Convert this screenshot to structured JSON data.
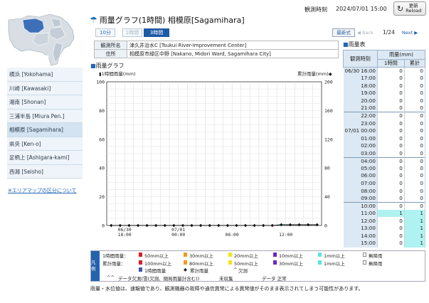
{
  "header": {
    "obs_time_label": "観測時刻",
    "obs_time_value": "2024/07/01 15:00",
    "reload_label_jp": "更新",
    "reload_label_en": "Reload"
  },
  "title": "雨量グラフ(1時間) 相模原[Sagamihara]",
  "tabs": [
    {
      "label": "10分",
      "state": "link"
    },
    {
      "label": "1時間",
      "state": "disabled"
    },
    {
      "label": "3時間",
      "state": "active"
    }
  ],
  "pager": {
    "latest": "最新式",
    "back": "◀ Back",
    "page": "1/24",
    "next": "Next ▶"
  },
  "info": [
    {
      "key": "観測所名",
      "value": "津久井治水C [Tsukui River-Improvement Center]"
    },
    {
      "key": "住所",
      "value": "相模原市緑区中野 [Nakano, Midori Ward, Sagamihara City]"
    }
  ],
  "sidebar": {
    "items": [
      {
        "label": "横浜 [Yokohama]",
        "active": false
      },
      {
        "label": "川崎 [Kawasaki]",
        "active": false
      },
      {
        "label": "湘南 [Shonan]",
        "active": false
      },
      {
        "label": "三浦半島 [Miura Pen.]",
        "active": false
      },
      {
        "label": "相模原 [Sagamihara]",
        "active": true
      },
      {
        "label": "県央 [Ken-o]",
        "active": false
      },
      {
        "label": "足柄上 [Ashigara-kami]",
        "active": false
      },
      {
        "label": "西湘 [Seisho]",
        "active": false
      }
    ],
    "area_note": "※エリアマップの区分について"
  },
  "graph": {
    "title": "雨量グラフ",
    "left_unit": "1時間雨量(mm)",
    "right_unit": "累計雨量(mm)"
  },
  "chart_data": {
    "type": "bar",
    "left_axis": {
      "min": 0,
      "max": 100,
      "ticks": [
        0,
        20,
        40,
        60,
        80,
        100
      ]
    },
    "right_axis": {
      "min": 0,
      "max": 200,
      "ticks": [
        0,
        40,
        80,
        120,
        160,
        200
      ]
    },
    "x_tick_labels": [
      {
        "line1": "06/30",
        "line2": "18:00",
        "index": 2
      },
      {
        "line1": "07/01",
        "line2": "00:00",
        "index": 8
      },
      {
        "line1": "",
        "line2": "06:00",
        "index": 14
      },
      {
        "line1": "",
        "line2": "12:00",
        "index": 20
      }
    ],
    "hours": [
      "16:00",
      "17:00",
      "18:00",
      "19:00",
      "20:00",
      "21:00",
      "22:00",
      "23:00",
      "00:00",
      "01:00",
      "02:00",
      "03:00",
      "04:00",
      "05:00",
      "06:00",
      "07:00",
      "08:00",
      "09:00",
      "10:00",
      "11:00",
      "12:00",
      "13:00",
      "14:00",
      "15:00"
    ],
    "hourly_rain": [
      0,
      0,
      0,
      0,
      0,
      0,
      0,
      0,
      0,
      0,
      0,
      0,
      0,
      0,
      0,
      0,
      0,
      0,
      0,
      1,
      0,
      0,
      0,
      0
    ],
    "cumulative": [
      0,
      0,
      0,
      0,
      0,
      0,
      0,
      0,
      0,
      0,
      0,
      0,
      0,
      0,
      0,
      0,
      0,
      0,
      0,
      1,
      1,
      1,
      1,
      1
    ]
  },
  "legend": {
    "label": "凡例",
    "row1_label": "1時間雨量：",
    "row2_label": "累計雨量：",
    "row1": [
      {
        "text": "50mm以上",
        "color": "#d8202a"
      },
      {
        "text": "30mm以上",
        "color": "#f29a1d"
      },
      {
        "text": "20mm以上",
        "color": "#f4e21b"
      },
      {
        "text": "10mm以上",
        "color": "#6a2ab8"
      },
      {
        "text": "1mm以上",
        "color": "#5fe3e0"
      },
      {
        "text": "無降雨",
        "color": "#ffffff"
      }
    ],
    "row2": [
      {
        "text": "100mm以上",
        "color": "#d8202a"
      },
      {
        "text": "80mm以上",
        "color": "#f29a1d"
      },
      {
        "text": "50mm以上",
        "color": "#f4e21b"
      },
      {
        "text": "30mm以上",
        "color": "#6a2ab8"
      },
      {
        "text": "1mm以上",
        "color": "#5fe3e0"
      },
      {
        "text": "無降雨",
        "color": "#ffffff"
      }
    ],
    "row3a": "1時間雨量",
    "row3b": "累計雨量",
    "row3c": "欠測",
    "row4a": "データ欠測(雪(欠測、閉局雨量計含む))",
    "row4b": "未収集",
    "row4c": "データ 正常"
  },
  "footnote": "雨量・水位値は、速報値であり、観測機器の故障や通信異常による異常値がそのまま表示されてしまう可能性があります。",
  "rain_table": {
    "title": "雨量表",
    "col_time": "観測時刻",
    "col_group": "雨量(mm)",
    "col_1h": "1時間",
    "col_cum": "累計",
    "rows": [
      {
        "date": "06/30",
        "time": "16:00",
        "h": "0",
        "c": "0"
      },
      {
        "date": "",
        "time": "17:00",
        "h": "0",
        "c": "0"
      },
      {
        "date": "",
        "time": "18:00",
        "h": "0",
        "c": "0"
      },
      {
        "date": "",
        "time": "19:00",
        "h": "0",
        "c": "0"
      },
      {
        "date": "",
        "time": "20:00",
        "h": "0",
        "c": "0"
      },
      {
        "date": "",
        "time": "21:00",
        "h": "0",
        "c": "0"
      },
      {
        "date": "",
        "time": "22:00",
        "h": "0",
        "c": "0"
      },
      {
        "date": "",
        "time": "23:00",
        "h": "0",
        "c": "0"
      },
      {
        "date": "07/01",
        "time": "00:00",
        "h": "0",
        "c": "0"
      },
      {
        "date": "",
        "time": "01:00",
        "h": "0",
        "c": "0"
      },
      {
        "date": "",
        "time": "02:00",
        "h": "0",
        "c": "0"
      },
      {
        "date": "",
        "time": "03:00",
        "h": "0",
        "c": "0"
      },
      {
        "date": "",
        "time": "04:00",
        "h": "0",
        "c": "0"
      },
      {
        "date": "",
        "time": "05:00",
        "h": "0",
        "c": "0"
      },
      {
        "date": "",
        "time": "06:00",
        "h": "0",
        "c": "0"
      },
      {
        "date": "",
        "time": "07:00",
        "h": "0",
        "c": "0"
      },
      {
        "date": "",
        "time": "08:00",
        "h": "0",
        "c": "0"
      },
      {
        "date": "",
        "time": "09:00",
        "h": "0",
        "c": "0"
      },
      {
        "date": "",
        "time": "10:00",
        "h": "0",
        "c": "0"
      },
      {
        "date": "",
        "time": "11:00",
        "h": "1",
        "c": "1"
      },
      {
        "date": "",
        "time": "12:00",
        "h": "0",
        "c": "1"
      },
      {
        "date": "",
        "time": "13:00",
        "h": "0",
        "c": "1"
      },
      {
        "date": "",
        "time": "14:00",
        "h": "0",
        "c": "1"
      },
      {
        "date": "",
        "time": "15:00",
        "h": "0",
        "c": "1"
      }
    ]
  },
  "colors": {
    "accent": "#1d5aa6",
    "highlight": "#aef3f1",
    "bar": "#5fe3e0"
  }
}
